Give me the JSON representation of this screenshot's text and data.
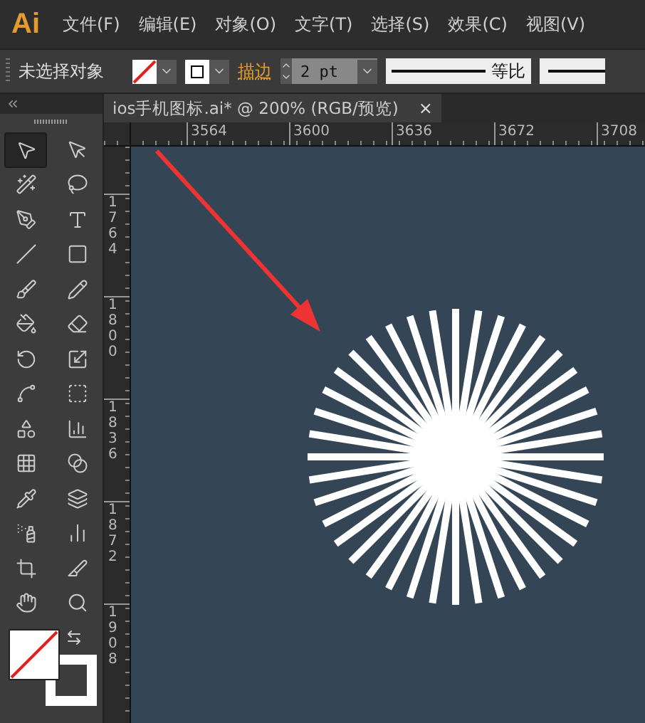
{
  "menu_bar": {
    "logo": "Ai",
    "items": [
      {
        "label": "文件(F)"
      },
      {
        "label": "编辑(E)"
      },
      {
        "label": "对象(O)"
      },
      {
        "label": "文字(T)"
      },
      {
        "label": "选择(S)"
      },
      {
        "label": "效果(C)"
      },
      {
        "label": "视图(V)"
      }
    ]
  },
  "control_bar": {
    "selection": "未选择对象",
    "stroke_label": "描边",
    "stroke_weight": "2 pt",
    "profile": "等比"
  },
  "document_tab": {
    "title": "ios手机图标.ai* @ 200% (RGB/预览)",
    "close": "×"
  },
  "horizontal_ruler": [
    "3564",
    "3600",
    "3636",
    "3672",
    "3708"
  ],
  "vertical_ruler": [
    "1764",
    "1800",
    "1836",
    "1872",
    "1908"
  ],
  "tools": [
    {
      "selected": true
    },
    {
      "selected": false
    },
    {
      "selected": false
    },
    {
      "selected": false
    },
    {
      "selected": false
    },
    {
      "selected": false
    },
    {
      "selected": false
    },
    {
      "selected": false
    },
    {
      "selected": false
    },
    {
      "selected": false
    },
    {
      "selected": false
    },
    {
      "selected": false
    },
    {
      "selected": false
    },
    {
      "selected": false
    },
    {
      "selected": false
    },
    {
      "selected": false
    },
    {
      "selected": false
    },
    {
      "selected": false
    },
    {
      "selected": false
    },
    {
      "selected": false
    },
    {
      "selected": false
    },
    {
      "selected": false
    },
    {
      "selected": false
    },
    {
      "selected": false
    },
    {
      "selected": false
    },
    {
      "selected": false
    },
    {
      "selected": false
    },
    {
      "selected": false
    }
  ]
}
